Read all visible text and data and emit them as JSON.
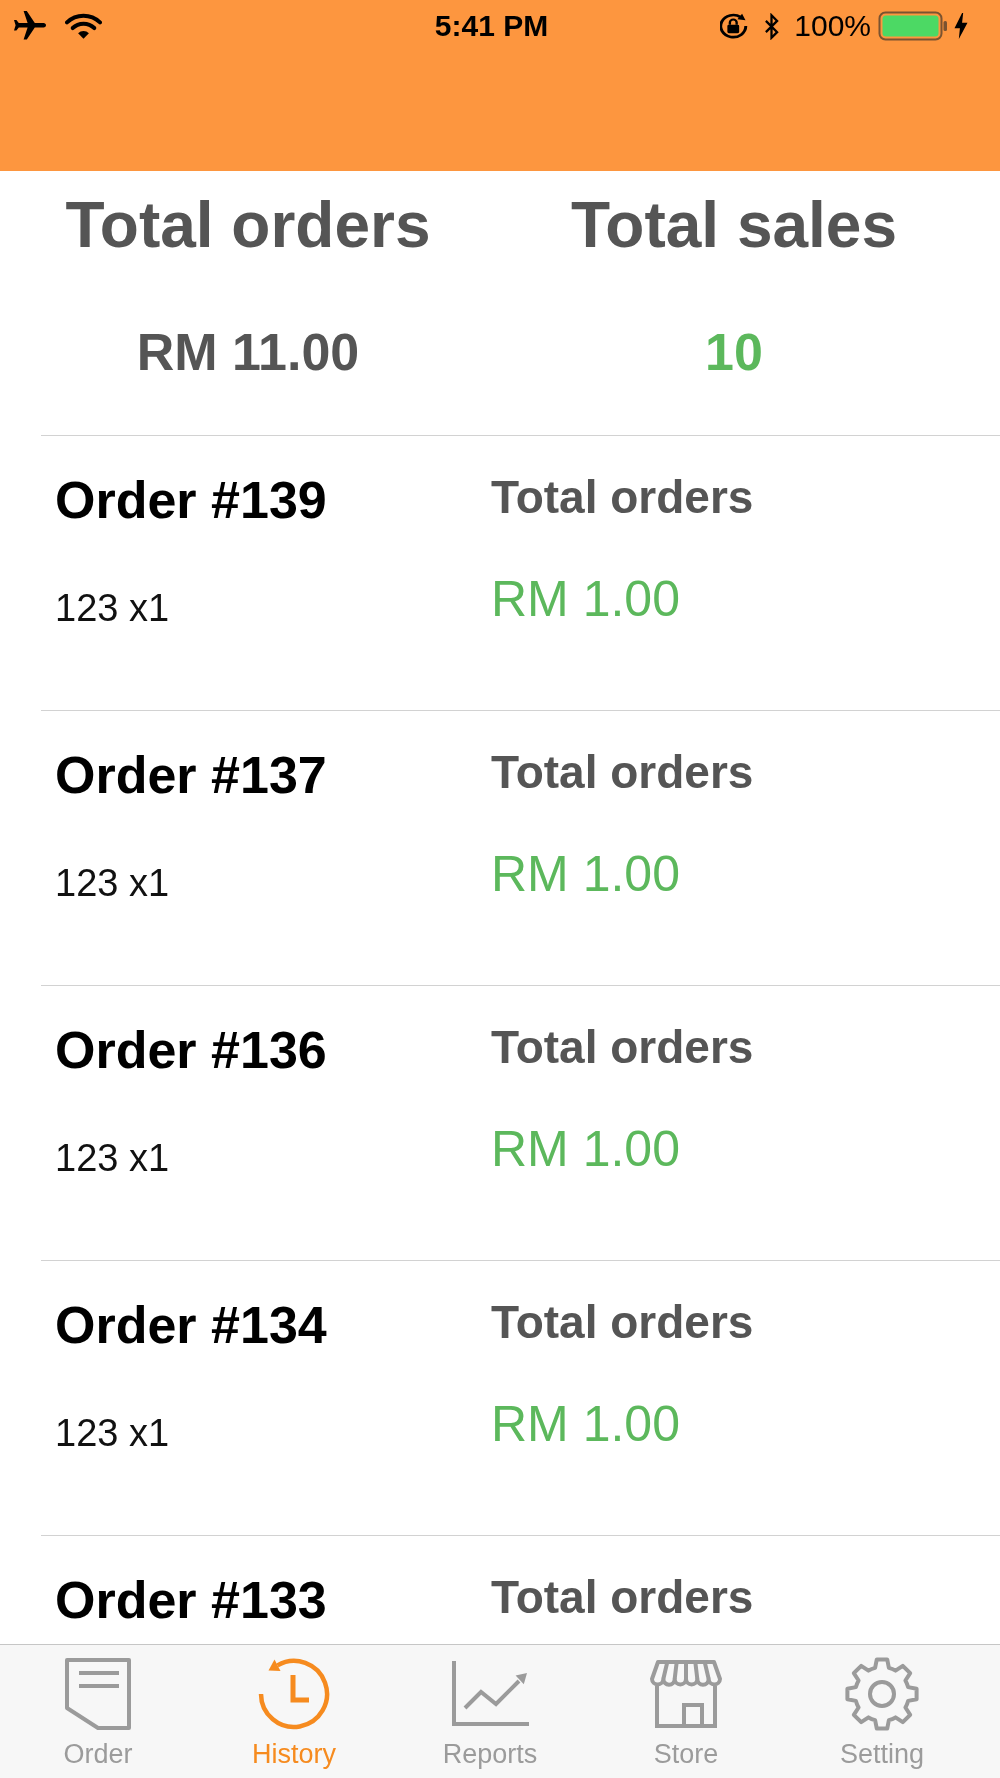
{
  "status_bar": {
    "time": "5:41 PM",
    "battery_percent": "100%"
  },
  "summary": {
    "columns": [
      {
        "label": "Total orders",
        "value": "RM 11.00",
        "color": "#555555"
      },
      {
        "label": "Total sales",
        "value": "10",
        "color": "#5cb85c"
      }
    ]
  },
  "orders": [
    {
      "title": "Order #139",
      "items": "123 x1",
      "total_label": "Total orders",
      "total": "RM 1.00"
    },
    {
      "title": "Order #137",
      "items": "123 x1",
      "total_label": "Total orders",
      "total": "RM 1.00"
    },
    {
      "title": "Order #136",
      "items": "123 x1",
      "total_label": "Total orders",
      "total": "RM 1.00"
    },
    {
      "title": "Order #134",
      "items": "123 x1",
      "total_label": "Total orders",
      "total": "RM 1.00"
    },
    {
      "title": "Order #133",
      "total_label": "Total orders"
    }
  ],
  "tab_bar": [
    {
      "label": "Order",
      "selected": false
    },
    {
      "label": "History",
      "selected": true
    },
    {
      "label": "Reports",
      "selected": false
    },
    {
      "label": "Store",
      "selected": false
    },
    {
      "label": "Setting",
      "selected": false
    }
  ]
}
